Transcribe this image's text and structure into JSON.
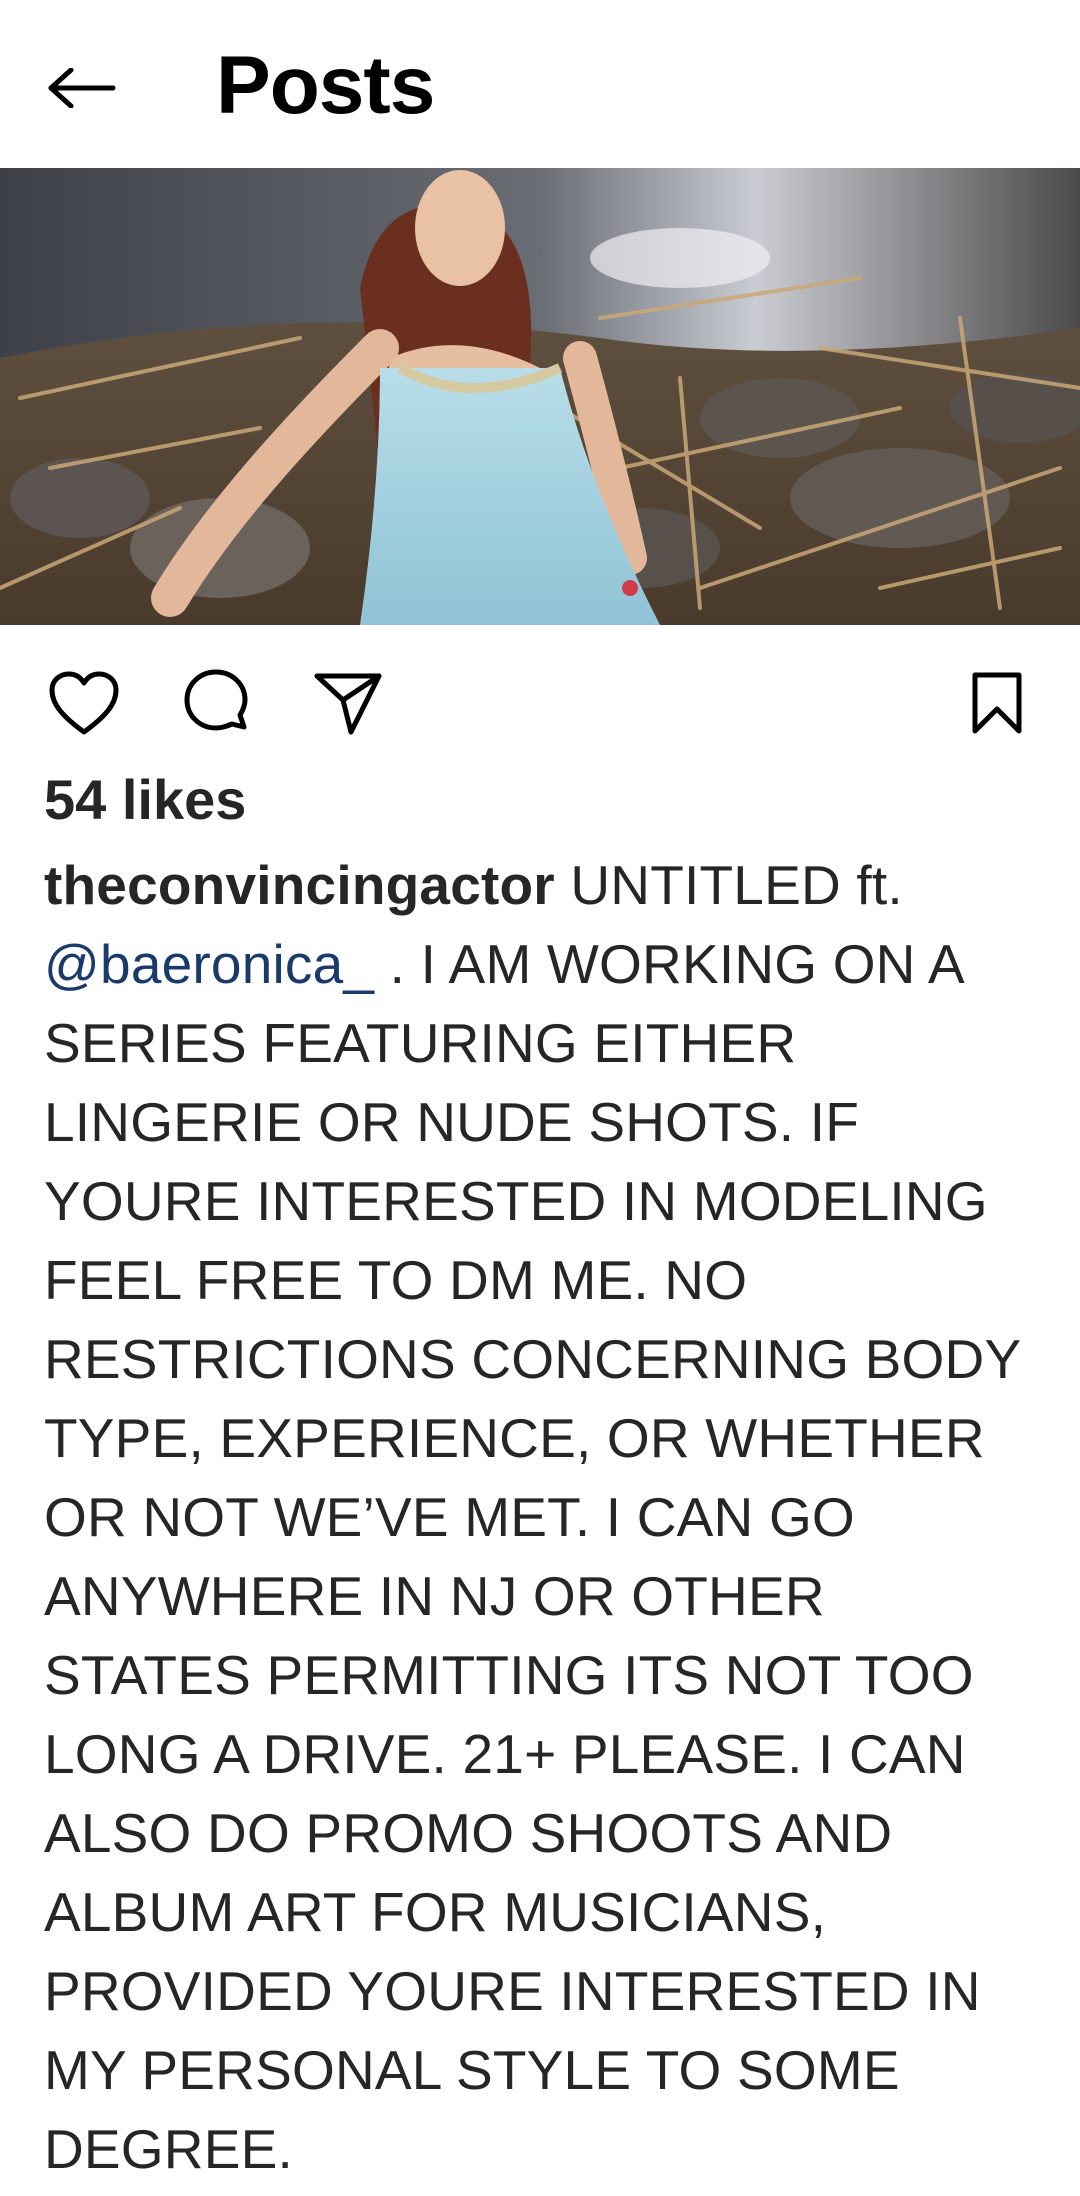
{
  "header": {
    "back_icon": "arrow-left-icon",
    "title": "Posts"
  },
  "post": {
    "image_icon": "photo",
    "actions": {
      "like_icon": "heart-icon",
      "comment_icon": "comment-icon",
      "share_icon": "send-icon",
      "save_icon": "bookmark-icon"
    },
    "likes_text": "54 likes",
    "caption": {
      "username": "theconvincingactor",
      "text_before_mention": " UNTITLED ft. ",
      "mention": "@baeronica_",
      "text_after_mention": " . I AM WORKING ON A SERIES FEATURING EITHER LINGERIE OR NUDE SHOTS. IF YOURE INTERESTED IN MODELING FEEL FREE TO DM ME. NO RESTRICTIONS CONCERNING BODY TYPE, EXPERIENCE, OR WHETHER OR NOT WE’VE MET. I CAN GO ANYWHERE IN NJ OR OTHER STATES PERMITTING ITS NOT TOO LONG A DRIVE. 21+ PLEASE. I CAN ALSO DO PROMO SHOOTS AND ALBUM ART FOR MUSICIANS, PROVIDED YOURE INTERESTED IN MY PERSONAL STYLE TO SOME DEGREE."
    }
  },
  "colors": {
    "text": "#262626",
    "mention": "#1a3a6b",
    "background": "#ffffff"
  }
}
